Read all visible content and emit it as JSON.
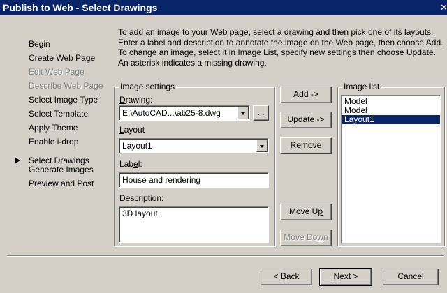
{
  "window": {
    "title": "Publish to Web - Select Drawings",
    "close_glyph": "✕"
  },
  "nav": {
    "items": [
      {
        "label": "Begin",
        "disabled": false
      },
      {
        "label": "Create Web Page",
        "disabled": false
      },
      {
        "label": "Edit Web Page",
        "disabled": true
      },
      {
        "label": "Describe Web Page",
        "disabled": true
      },
      {
        "label": "Select Image Type",
        "disabled": false
      },
      {
        "label": "Select Template",
        "disabled": false
      },
      {
        "label": "Apply Theme",
        "disabled": false
      },
      {
        "label": "Enable i-drop",
        "disabled": false
      },
      {
        "label": "Select Drawings",
        "disabled": false,
        "current": true
      },
      {
        "label": "Generate Images",
        "disabled": false
      },
      {
        "label": "Preview and Post",
        "disabled": false
      }
    ]
  },
  "instructions": "To add an image to your Web page, select a drawing and then pick one of its layouts. Enter a label and description to annotate the image on the Web page, then choose Add. To change an image, select it in Image List, specify new settings then choose Update. An asterisk indicates a missing drawing.",
  "image_settings": {
    "legend": "Image settings",
    "drawing": {
      "label_u": "D",
      "label_rest": "rawing:",
      "value": "E:\\AutoCAD...\\ab25-8.dwg",
      "browse_label": "..."
    },
    "layout": {
      "label_u": "L",
      "label_rest": "ayout",
      "value": "Layout1"
    },
    "label": {
      "label_pre": "Lab",
      "label_u": "e",
      "label_rest": "l:",
      "value": "House and rendering"
    },
    "description": {
      "label_pre": "De",
      "label_u": "s",
      "label_rest": "cription:",
      "value": "3D layout"
    }
  },
  "actions": {
    "add": {
      "u": "A",
      "rest": "dd ->"
    },
    "update": {
      "u": "U",
      "rest": "pdate ->"
    },
    "remove": {
      "u": "R",
      "rest": "emove"
    },
    "move_up": {
      "pre": "Move U",
      "u": "p",
      "rest": ""
    },
    "move_down": {
      "pre": "Move Do",
      "u": "w",
      "rest": "n"
    }
  },
  "image_list": {
    "legend": "Image list",
    "items": [
      "Model",
      "Model",
      "Layout1"
    ],
    "selected_index": 2
  },
  "footer": {
    "back": {
      "pre": "< ",
      "u": "B",
      "rest": "ack"
    },
    "next": {
      "u": "N",
      "rest": "ext >"
    },
    "cancel": "Cancel"
  },
  "colors": {
    "titlebar": "#0a246a",
    "face": "#d4d0c8",
    "selection": "#0a246a"
  }
}
